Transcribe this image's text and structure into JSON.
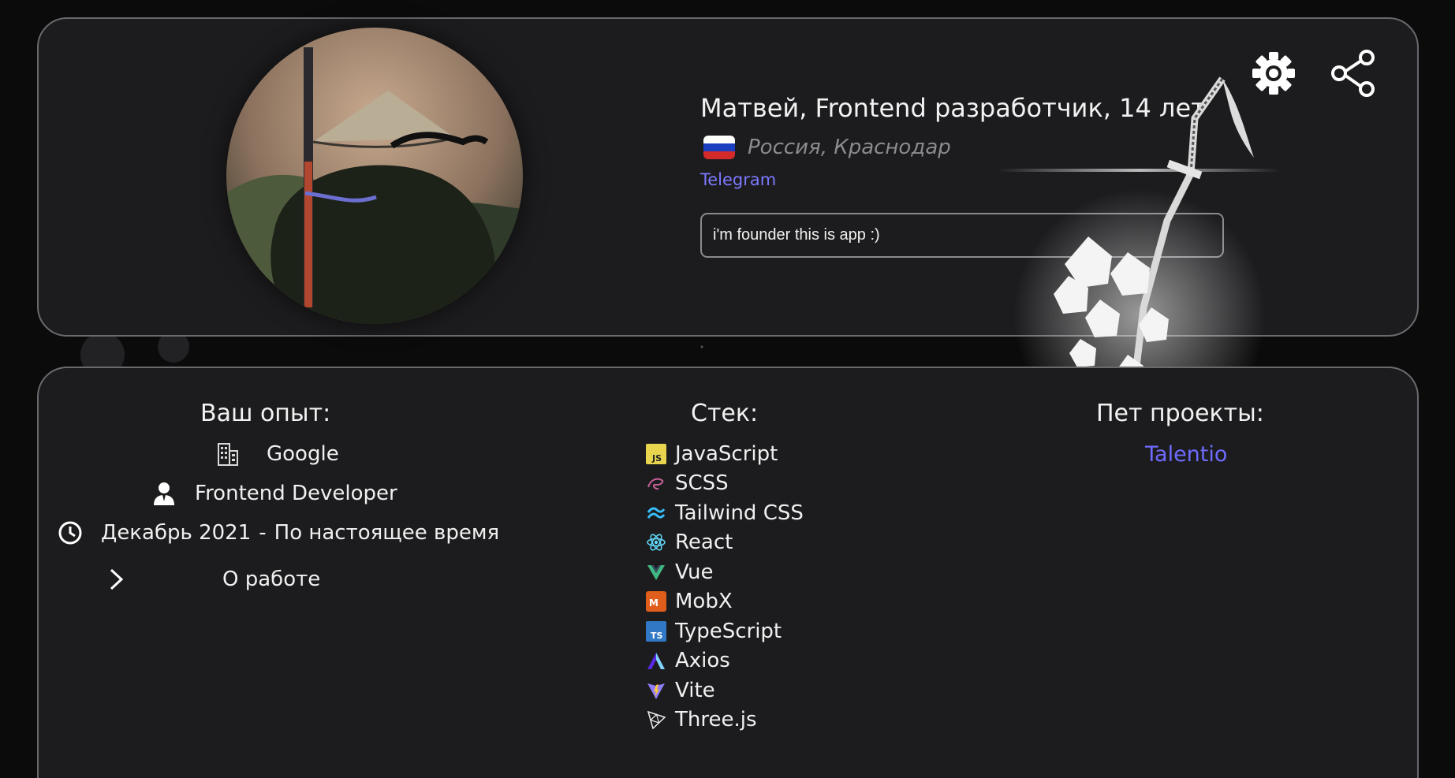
{
  "profile": {
    "name_line": "Матвей, Frontend разработчик, 14 лет",
    "location": "Россия, Краснодар",
    "telegram_label": "Telegram",
    "bio": "i'm founder this is app :)"
  },
  "actions": {
    "settings_icon": "gear-icon",
    "share_icon": "share-icon"
  },
  "experience": {
    "title": "Ваш опыт:",
    "company": "Google",
    "position": "Frontend Developer",
    "period_start": "Декабрь 2021",
    "period_sep": "-",
    "period_end": "По настоящее время",
    "about_label": "О работе"
  },
  "stack": {
    "title": "Стек:",
    "items": [
      {
        "label": "JavaScript",
        "icon": "javascript-icon"
      },
      {
        "label": "SCSS",
        "icon": "sass-icon"
      },
      {
        "label": "Tailwind CSS",
        "icon": "tailwind-icon"
      },
      {
        "label": "React",
        "icon": "react-icon"
      },
      {
        "label": "Vue",
        "icon": "vue-icon"
      },
      {
        "label": "MobX",
        "icon": "mobx-icon"
      },
      {
        "label": "TypeScript",
        "icon": "typescript-icon"
      },
      {
        "label": "Axios",
        "icon": "axios-icon"
      },
      {
        "label": "Vite",
        "icon": "vite-icon"
      },
      {
        "label": "Three.js",
        "icon": "threejs-icon"
      }
    ]
  },
  "pet_projects": {
    "title": "Пет проекты:",
    "items": [
      "Talentio"
    ]
  },
  "colors": {
    "background": "#0b0b0c",
    "card": "#1c1c1e",
    "border": "#6a6a6e",
    "link": "#7c79ff",
    "muted": "#8b8b90"
  }
}
